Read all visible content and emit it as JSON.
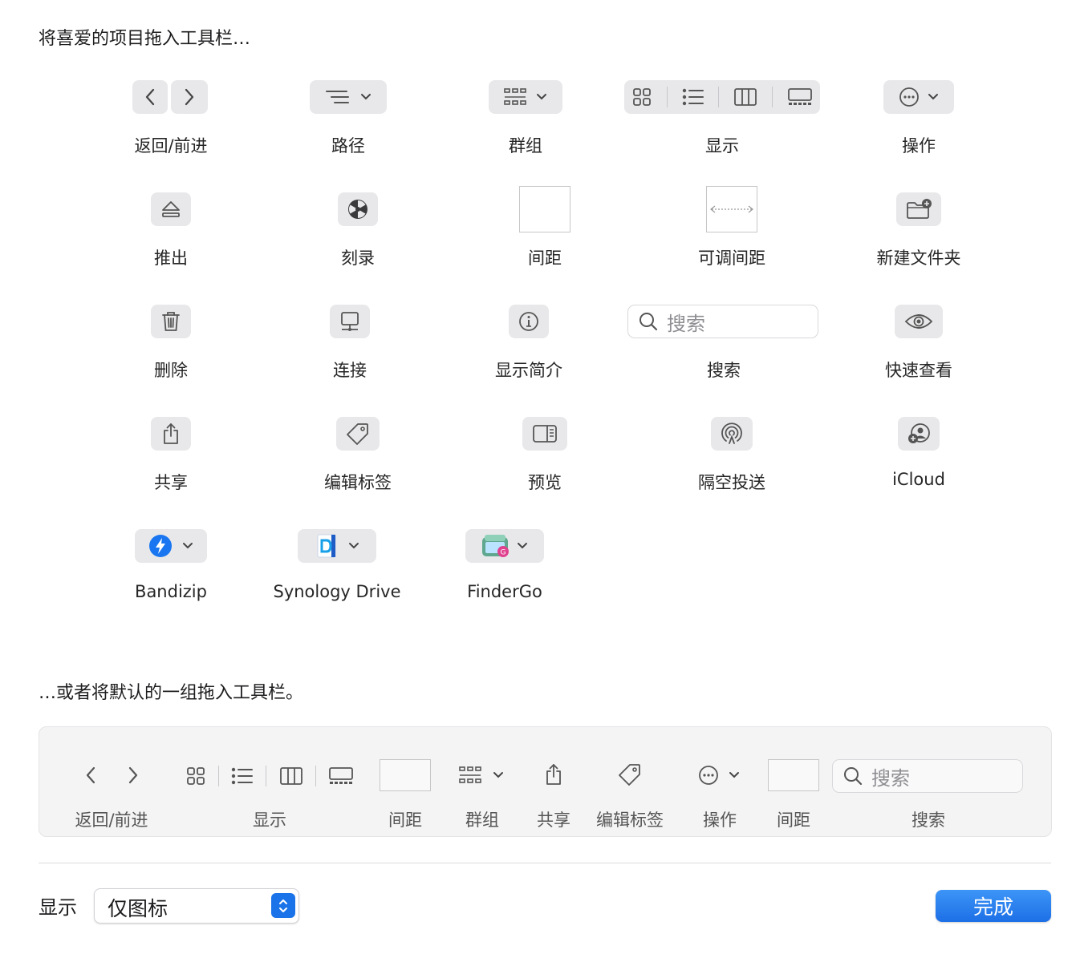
{
  "heading_top": "将喜爱的项目拖入工具栏…",
  "heading_default": "…或者将默认的一组拖入工具栏。",
  "items": {
    "back_forward": "返回/前进",
    "path": "路径",
    "group": "群组",
    "view": "显示",
    "action": "操作",
    "eject": "推出",
    "burn": "刻录",
    "space": "间距",
    "flex_space": "可调间距",
    "new_folder": "新建文件夹",
    "delete": "删除",
    "connect": "连接",
    "get_info": "显示简介",
    "search": "搜索",
    "quick_look": "快速查看",
    "share": "共享",
    "edit_tags": "编辑标签",
    "preview": "预览",
    "airdrop": "隔空投送",
    "icloud": "iCloud",
    "bandizip": "Bandizip",
    "synology": "Synology Drive",
    "findergo": "FinderGo"
  },
  "search_placeholder": "搜索",
  "default_set": {
    "back_forward": "返回/前进",
    "view": "显示",
    "space1": "间距",
    "group": "群组",
    "share": "共享",
    "edit_tags": "编辑标签",
    "action": "操作",
    "space2": "间距",
    "search": "搜索",
    "search_placeholder": "搜索"
  },
  "footer": {
    "show_label": "显示",
    "show_value": "仅图标",
    "done": "完成"
  },
  "colors": {
    "accent": "#1a73e8",
    "button_bg": "#e8e8ea"
  }
}
